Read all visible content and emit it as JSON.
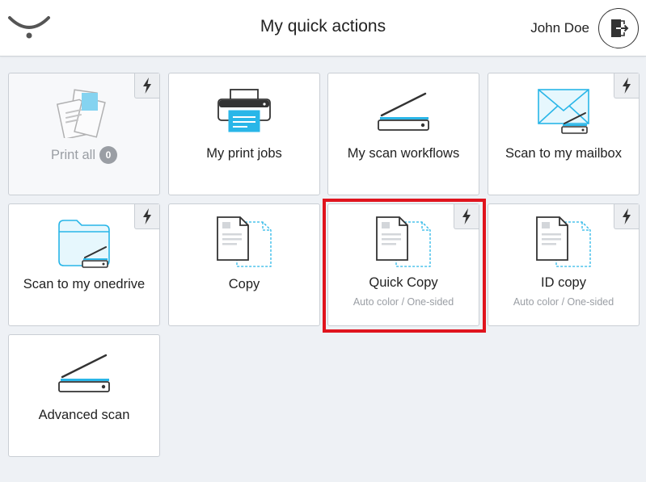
{
  "header": {
    "title": "My quick actions",
    "user_name": "John Doe"
  },
  "tiles": [
    {
      "label": "Print all",
      "badge": "0",
      "icon": "print-all-icon",
      "flash": true,
      "disabled": true
    },
    {
      "label": "My print jobs",
      "icon": "printer-icon",
      "flash": false
    },
    {
      "label": "My scan workflows",
      "icon": "scanner-icon",
      "flash": false
    },
    {
      "label": "Scan to my mailbox",
      "icon": "mailbox-scan-icon",
      "flash": true
    },
    {
      "label": "Scan to my onedrive",
      "icon": "folder-scan-icon",
      "flash": true
    },
    {
      "label": "Copy",
      "icon": "copy-icon",
      "flash": false
    },
    {
      "label": "Quick Copy",
      "sublabel": "Auto color / One-sided",
      "icon": "copy-icon",
      "flash": true,
      "highlighted": true
    },
    {
      "label": "ID copy",
      "sublabel": "Auto color / One-sided",
      "icon": "copy-icon",
      "flash": true
    },
    {
      "label": "Advanced scan",
      "icon": "scanner-icon",
      "flash": false
    }
  ],
  "colors": {
    "accent": "#29b6e8",
    "highlight": "#e0141e",
    "muted": "#9a9ea4"
  }
}
